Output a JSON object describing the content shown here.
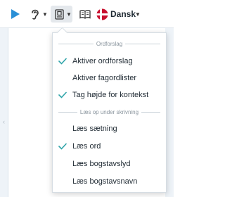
{
  "toolbar": {
    "language_label": "Dansk",
    "accent_color": "#2a8fd6",
    "flag_colors": {
      "red": "#c8102e",
      "white": "#ffffff"
    }
  },
  "menu": {
    "check_color": "#2fa4a9",
    "sections": [
      {
        "header": "Ordforslag",
        "items": [
          {
            "label": "Aktiver ordforslag",
            "checked": true
          },
          {
            "label": "Aktiver fagordlister",
            "checked": false
          },
          {
            "label": "Tag højde for kontekst",
            "checked": true
          }
        ]
      },
      {
        "header": "Læs op under skrivning",
        "items": [
          {
            "label": "Læs sætning",
            "checked": false
          },
          {
            "label": "Læs ord",
            "checked": true
          },
          {
            "label": "Læs bogstavslyd",
            "checked": false
          },
          {
            "label": "Læs bogstavsnavn",
            "checked": false
          }
        ]
      }
    ]
  }
}
